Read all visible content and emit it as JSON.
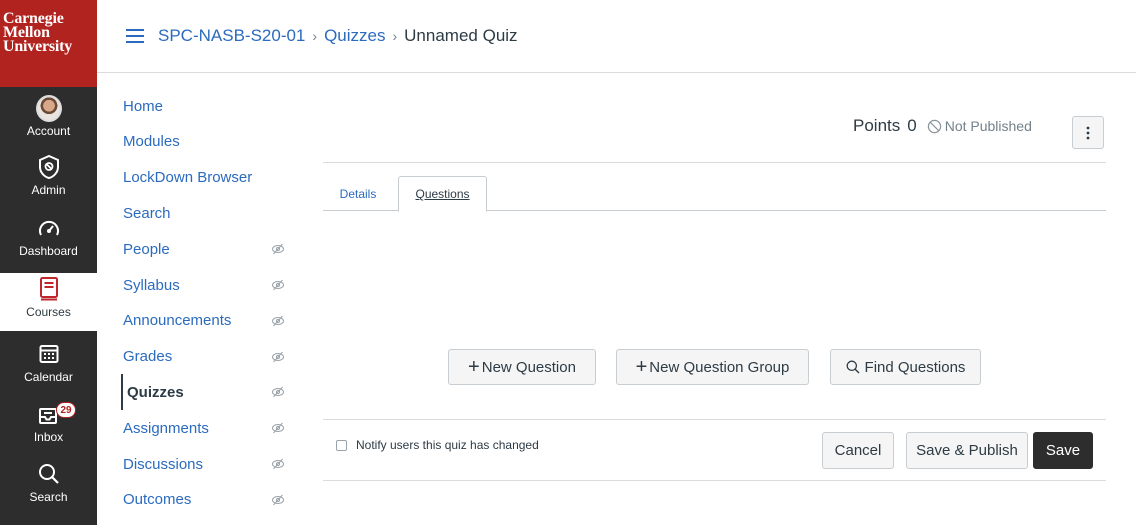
{
  "brand": {
    "logo_lines": [
      "Carnegie",
      "Mellon",
      "University"
    ],
    "logo_color": "#b1231f",
    "nav_bg": "#2d2d2d",
    "link_color": "#2b6bbf"
  },
  "global_nav": {
    "items": [
      {
        "label": "Account",
        "icon": "avatar"
      },
      {
        "label": "Admin",
        "icon": "shield-icon"
      },
      {
        "label": "Dashboard",
        "icon": "dashboard-icon"
      },
      {
        "label": "Courses",
        "icon": "book-icon",
        "active": true
      },
      {
        "label": "Calendar",
        "icon": "calendar-icon"
      },
      {
        "label": "Inbox",
        "icon": "inbox-icon",
        "badge": "29"
      },
      {
        "label": "Search",
        "icon": "search-icon"
      }
    ]
  },
  "breadcrumb": {
    "course": "SPC-NASB-S20-01",
    "section": "Quizzes",
    "current": "Unnamed Quiz",
    "separator": "›"
  },
  "course_nav": {
    "items": [
      {
        "label": "Home",
        "hidden": false
      },
      {
        "label": "Modules",
        "hidden": false
      },
      {
        "label": "LockDown Browser",
        "hidden": false
      },
      {
        "label": "Search",
        "hidden": false
      },
      {
        "label": "People",
        "hidden": true
      },
      {
        "label": "Syllabus",
        "hidden": true
      },
      {
        "label": "Announcements",
        "hidden": true
      },
      {
        "label": "Grades",
        "hidden": true
      },
      {
        "label": "Quizzes",
        "hidden": true,
        "active": true
      },
      {
        "label": "Assignments",
        "hidden": true
      },
      {
        "label": "Discussions",
        "hidden": true
      },
      {
        "label": "Outcomes",
        "hidden": true
      }
    ]
  },
  "quiz_header": {
    "points_label": "Points",
    "points_value": "0",
    "status": "Not Published",
    "more_icon": "kebab-icon"
  },
  "tabs": [
    {
      "label": "Details",
      "active": false
    },
    {
      "label": "Questions",
      "active": true
    }
  ],
  "actions": {
    "new_question": "New Question",
    "new_question_group": "New Question Group",
    "find_questions": "Find Questions"
  },
  "footer": {
    "notify_label": "Notify users this quiz has changed",
    "notify_checked": false,
    "cancel": "Cancel",
    "save_publish": "Save & Publish",
    "save": "Save"
  }
}
